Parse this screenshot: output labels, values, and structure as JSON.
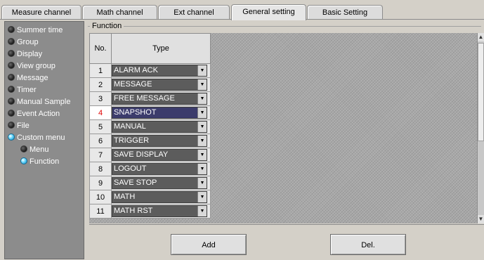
{
  "tabs": [
    {
      "label": "Measure channel",
      "active": false
    },
    {
      "label": "Math channel",
      "active": false
    },
    {
      "label": "Ext channel",
      "active": false
    },
    {
      "label": "General setting",
      "active": true
    },
    {
      "label": "Basic Setting",
      "active": false
    }
  ],
  "sidebar": {
    "items": [
      {
        "label": "Summer time",
        "selected": false
      },
      {
        "label": "Group",
        "selected": false
      },
      {
        "label": "Display",
        "selected": false
      },
      {
        "label": "View group",
        "selected": false
      },
      {
        "label": "Message",
        "selected": false
      },
      {
        "label": "Timer",
        "selected": false
      },
      {
        "label": "Manual Sample",
        "selected": false
      },
      {
        "label": "Event Action",
        "selected": false
      },
      {
        "label": "File",
        "selected": false
      },
      {
        "label": "Custom menu",
        "selected": true
      },
      {
        "label": "Menu",
        "selected": false
      },
      {
        "label": "Function",
        "selected": true
      }
    ]
  },
  "main": {
    "group_label": "Function",
    "col_no": "No.",
    "col_type": "Type",
    "rows": [
      {
        "no": "1",
        "type": "ALARM ACK"
      },
      {
        "no": "2",
        "type": "MESSAGE"
      },
      {
        "no": "3",
        "type": "FREE MESSAGE"
      },
      {
        "no": "4",
        "type": "SNAPSHOT"
      },
      {
        "no": "5",
        "type": "MANUAL"
      },
      {
        "no": "6",
        "type": "TRIGGER"
      },
      {
        "no": "7",
        "type": "SAVE DISPLAY"
      },
      {
        "no": "8",
        "type": "LOGOUT"
      },
      {
        "no": "9",
        "type": "SAVE STOP"
      },
      {
        "no": "10",
        "type": "MATH"
      },
      {
        "no": "11",
        "type": "MATH RST"
      }
    ],
    "selected_row": "4"
  },
  "footer": {
    "add_label": "Add",
    "del_label": "Del."
  },
  "colors": {
    "selected_row_number": "#e00000",
    "selected_indicator": "#1ea0d8",
    "sidebar_bg": "#8c8c8c",
    "combo_bg": "#5c5c5c"
  }
}
